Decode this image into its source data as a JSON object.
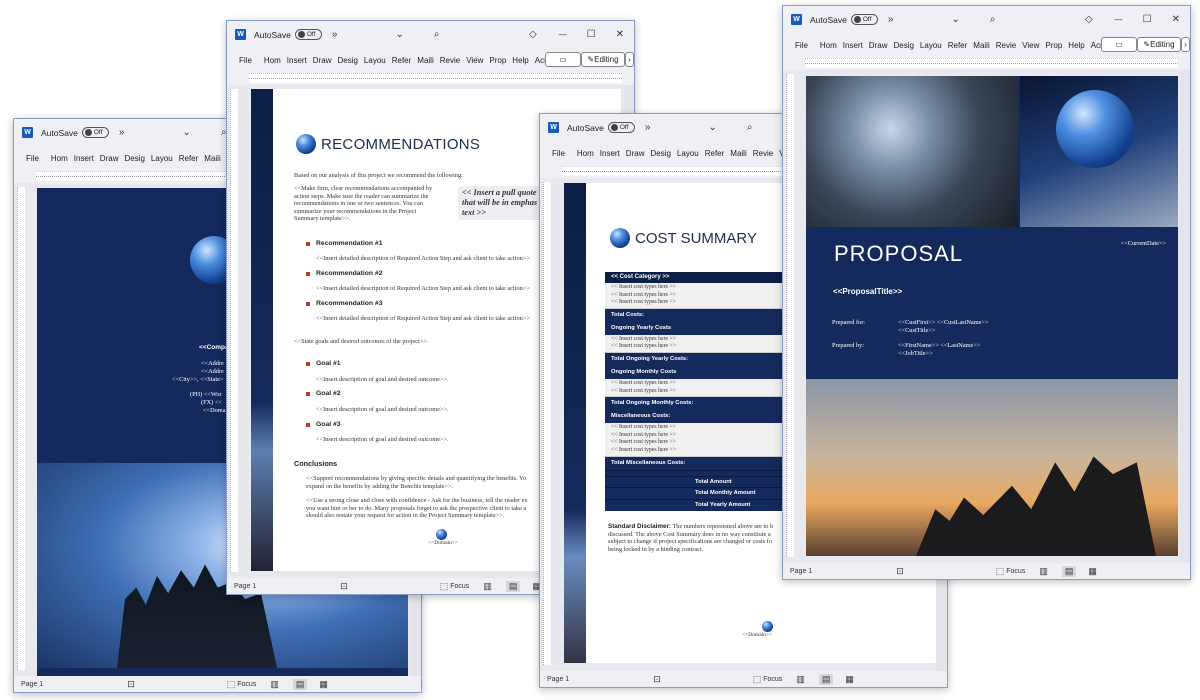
{
  "chrome": {
    "app_icon": "word-icon",
    "autosave_label": "AutoSave",
    "autosave_state": "Off",
    "overflow_glyph": "»",
    "tabs": [
      "File",
      "Hom",
      "Insert",
      "Draw",
      "Desig",
      "Layou",
      "Refer",
      "Maili",
      "Revie",
      "View",
      "Prop",
      "Help",
      "Acrol"
    ],
    "editing_label": "Editing",
    "status_page": "Page 1",
    "focus_label": "Focus"
  },
  "windows": [
    {
      "name": "cover-company",
      "company_lines": [
        "<<Compa",
        "<<Addre",
        "<<Addre",
        "<<City>>, <<State>",
        "(PH) <<Wor",
        "(FX) <<",
        "<<Domai"
      ]
    },
    {
      "name": "recommendations",
      "title": "RECOMMENDATIONS",
      "intro": "Based on our analysis of this project we recommend the following:",
      "para": [
        "<<Make firm, clear recommendations accompanied by",
        "action steps.  Make sure the reader can summarize the",
        "recommendations in one or two sentences.  You can",
        "summarize your recommendations in the Project",
        "Summary template>>."
      ],
      "pull_quote": [
        "<< Insert a pull quote",
        "that will be in emphas",
        "text >>"
      ],
      "recommendations": [
        {
          "title": "Recommendation #1",
          "desc": "<<Insert detailed description of Required Action Step and ask client to take action>>"
        },
        {
          "title": "Recommendation #2",
          "desc": "<<Insert detailed description of Required Action Step and ask client to take action>>"
        },
        {
          "title": "Recommendation #3",
          "desc": "<<Insert detailed description of Required Action Step and ask client to take action>>"
        }
      ],
      "goals_intro": "<<State goals and desired outcomes of the project>>.",
      "goals": [
        {
          "title": "Goal #1",
          "desc": "<<Insert description of goal and desired outcome>>."
        },
        {
          "title": "Goal #2",
          "desc": "<<Insert description of goal and desired outcome>>."
        },
        {
          "title": "Goal #3",
          "desc": "<<Insert description of goal and desired outcome>>."
        }
      ],
      "conclusions_heading": "Conclusions",
      "conclusion1": [
        "<<Support recommendations by giving specific details and quantifying the benefits.  Yo",
        "expand on the benefits by adding the Benefits template>>."
      ],
      "conclusion2": [
        "<<Use a strong close and close with confidence - Ask for the business, tell the reader ex",
        "you want him or her to do.  Many proposals forget to ask the prospective client to take a",
        "should also restate your request for action in the Project Summary template>>."
      ],
      "domain": "<<Domain>>"
    },
    {
      "name": "cost-summary",
      "title": "COST SUMMARY",
      "rows": [
        {
          "type": "h",
          "text": "<< Cost Category >>"
        },
        {
          "type": "l",
          "lines": [
            "<< Insert cost types here >>",
            "<< Insert cost types here >>",
            "<< Insert cost types here >>"
          ]
        },
        {
          "type": "d",
          "text": "Total Costs:"
        },
        {
          "type": "d",
          "text": "Ongoing Yearly Costs"
        },
        {
          "type": "l",
          "lines": [
            "<< Insert cost types here >>",
            "<< Insert cost types here >>"
          ]
        },
        {
          "type": "d",
          "text": "Total Ongoing Yearly Costs:"
        },
        {
          "type": "d",
          "text": "Ongoing Monthly Costs"
        },
        {
          "type": "l",
          "lines": [
            "<< Insert cost types here >>",
            "<< Insert cost types here >>"
          ]
        },
        {
          "type": "d",
          "text": "Total Ongoing Monthly Costs:"
        },
        {
          "type": "d",
          "text": "Miscellaneous Costs:"
        },
        {
          "type": "l",
          "lines": [
            "<< Insert cost types here >>",
            "<< Insert cost types here >>",
            "<< Insert cost types here >>",
            "<< Insert cost types here >>"
          ]
        },
        {
          "type": "d",
          "text": "Total Miscellaneous Costs:"
        },
        {
          "type": "t",
          "text": ""
        },
        {
          "type": "t",
          "text": "Total Amount"
        },
        {
          "type": "t",
          "text": "Total Monthly Amount"
        },
        {
          "type": "t",
          "text": "Total Yearly Amount"
        }
      ],
      "disclaimer_label": "Standard Disclaimer:",
      "disclaimer": [
        " The numbers represented above are to b",
        "discussed. The above Cost Summary does in no way constitute a",
        "subject to change if project specifications are changed or costs fo",
        "being locked in by a binding contract."
      ],
      "domain": "<<Domain>>"
    },
    {
      "name": "proposal-cover",
      "title": "PROPOSAL",
      "date": "<<CurrentDate>>",
      "proposal_title": "<<ProposalTitle>>",
      "prepared_for_label": "Prepared for:",
      "prepared_for": [
        "<<CustFirst>> <<CustLastName>>",
        "<<CustTitle>>"
      ],
      "prepared_by_label": "Prepared by:",
      "prepared_by": [
        "<<FirstName>> <<LastName>>",
        "<<JobTitle>>"
      ]
    }
  ],
  "colors": {
    "navy": "#152a5c",
    "dark_navy": "#0c1f44",
    "bullet": "#c0392b",
    "word_blue": "#185abd"
  }
}
